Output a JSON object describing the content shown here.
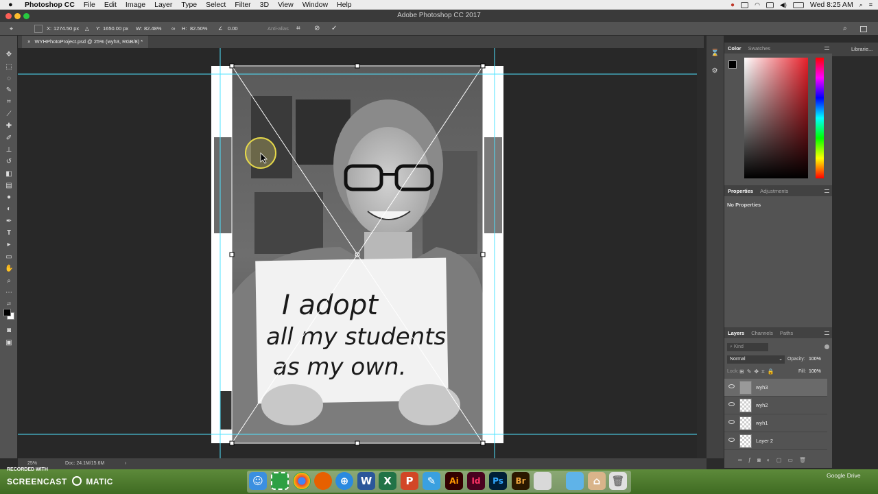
{
  "menubar": {
    "app_name": "Photoshop CC",
    "items": [
      "File",
      "Edit",
      "Image",
      "Layer",
      "Type",
      "Select",
      "Filter",
      "3D",
      "View",
      "Window",
      "Help"
    ],
    "clock": "Wed 8:25 AM"
  },
  "window": {
    "title": "Adobe Photoshop CC 2017"
  },
  "options": {
    "x_label": "X:",
    "x_value": "1274.50 px",
    "y_label": "Y:",
    "y_value": "1650.00 px",
    "w_label": "W:",
    "w_value": "82.48%",
    "h_label": "H:",
    "h_value": "82.50%",
    "angle_value": "0.00",
    "antialias": "Anti-alias"
  },
  "document": {
    "tab_title": "WYHPhotoProject.psd @ 25% (wyh3, RGB/8) *"
  },
  "sign_text": [
    "I adopt",
    "all my students",
    "as my own."
  ],
  "color_panel": {
    "tabs": [
      "Color",
      "Swatches"
    ],
    "active": "Color"
  },
  "libraries_label": "Librarie...",
  "properties_panel": {
    "tabs": [
      "Properties",
      "Adjustments"
    ],
    "empty_text": "No Properties"
  },
  "layers_panel": {
    "tabs": [
      "Layers",
      "Channels",
      "Paths"
    ],
    "kind_placeholder": "Kind",
    "blend_mode": "Normal",
    "opacity_label": "Opacity:",
    "opacity_value": "100%",
    "lock_label": "Lock:",
    "fill_label": "Fill:",
    "fill_value": "100%",
    "layers": [
      {
        "name": "wyh3",
        "selected": true
      },
      {
        "name": "wyh2",
        "selected": false
      },
      {
        "name": "wyh1",
        "selected": false
      },
      {
        "name": "Layer 2",
        "selected": false
      }
    ]
  },
  "status": {
    "zoom": "25%",
    "doc_size": "Doc: 24.1M/15.6M"
  },
  "watermark": {
    "recorded": "RECORDED WITH",
    "brand": "SCREENCAST",
    "brand2": "MATIC"
  },
  "desktop": {
    "google_drive": "Google Drive"
  },
  "colors": {
    "accent": "#31a8ff",
    "guide": "#4fe3ff",
    "panel": "#535353",
    "canvas": "#282828"
  }
}
